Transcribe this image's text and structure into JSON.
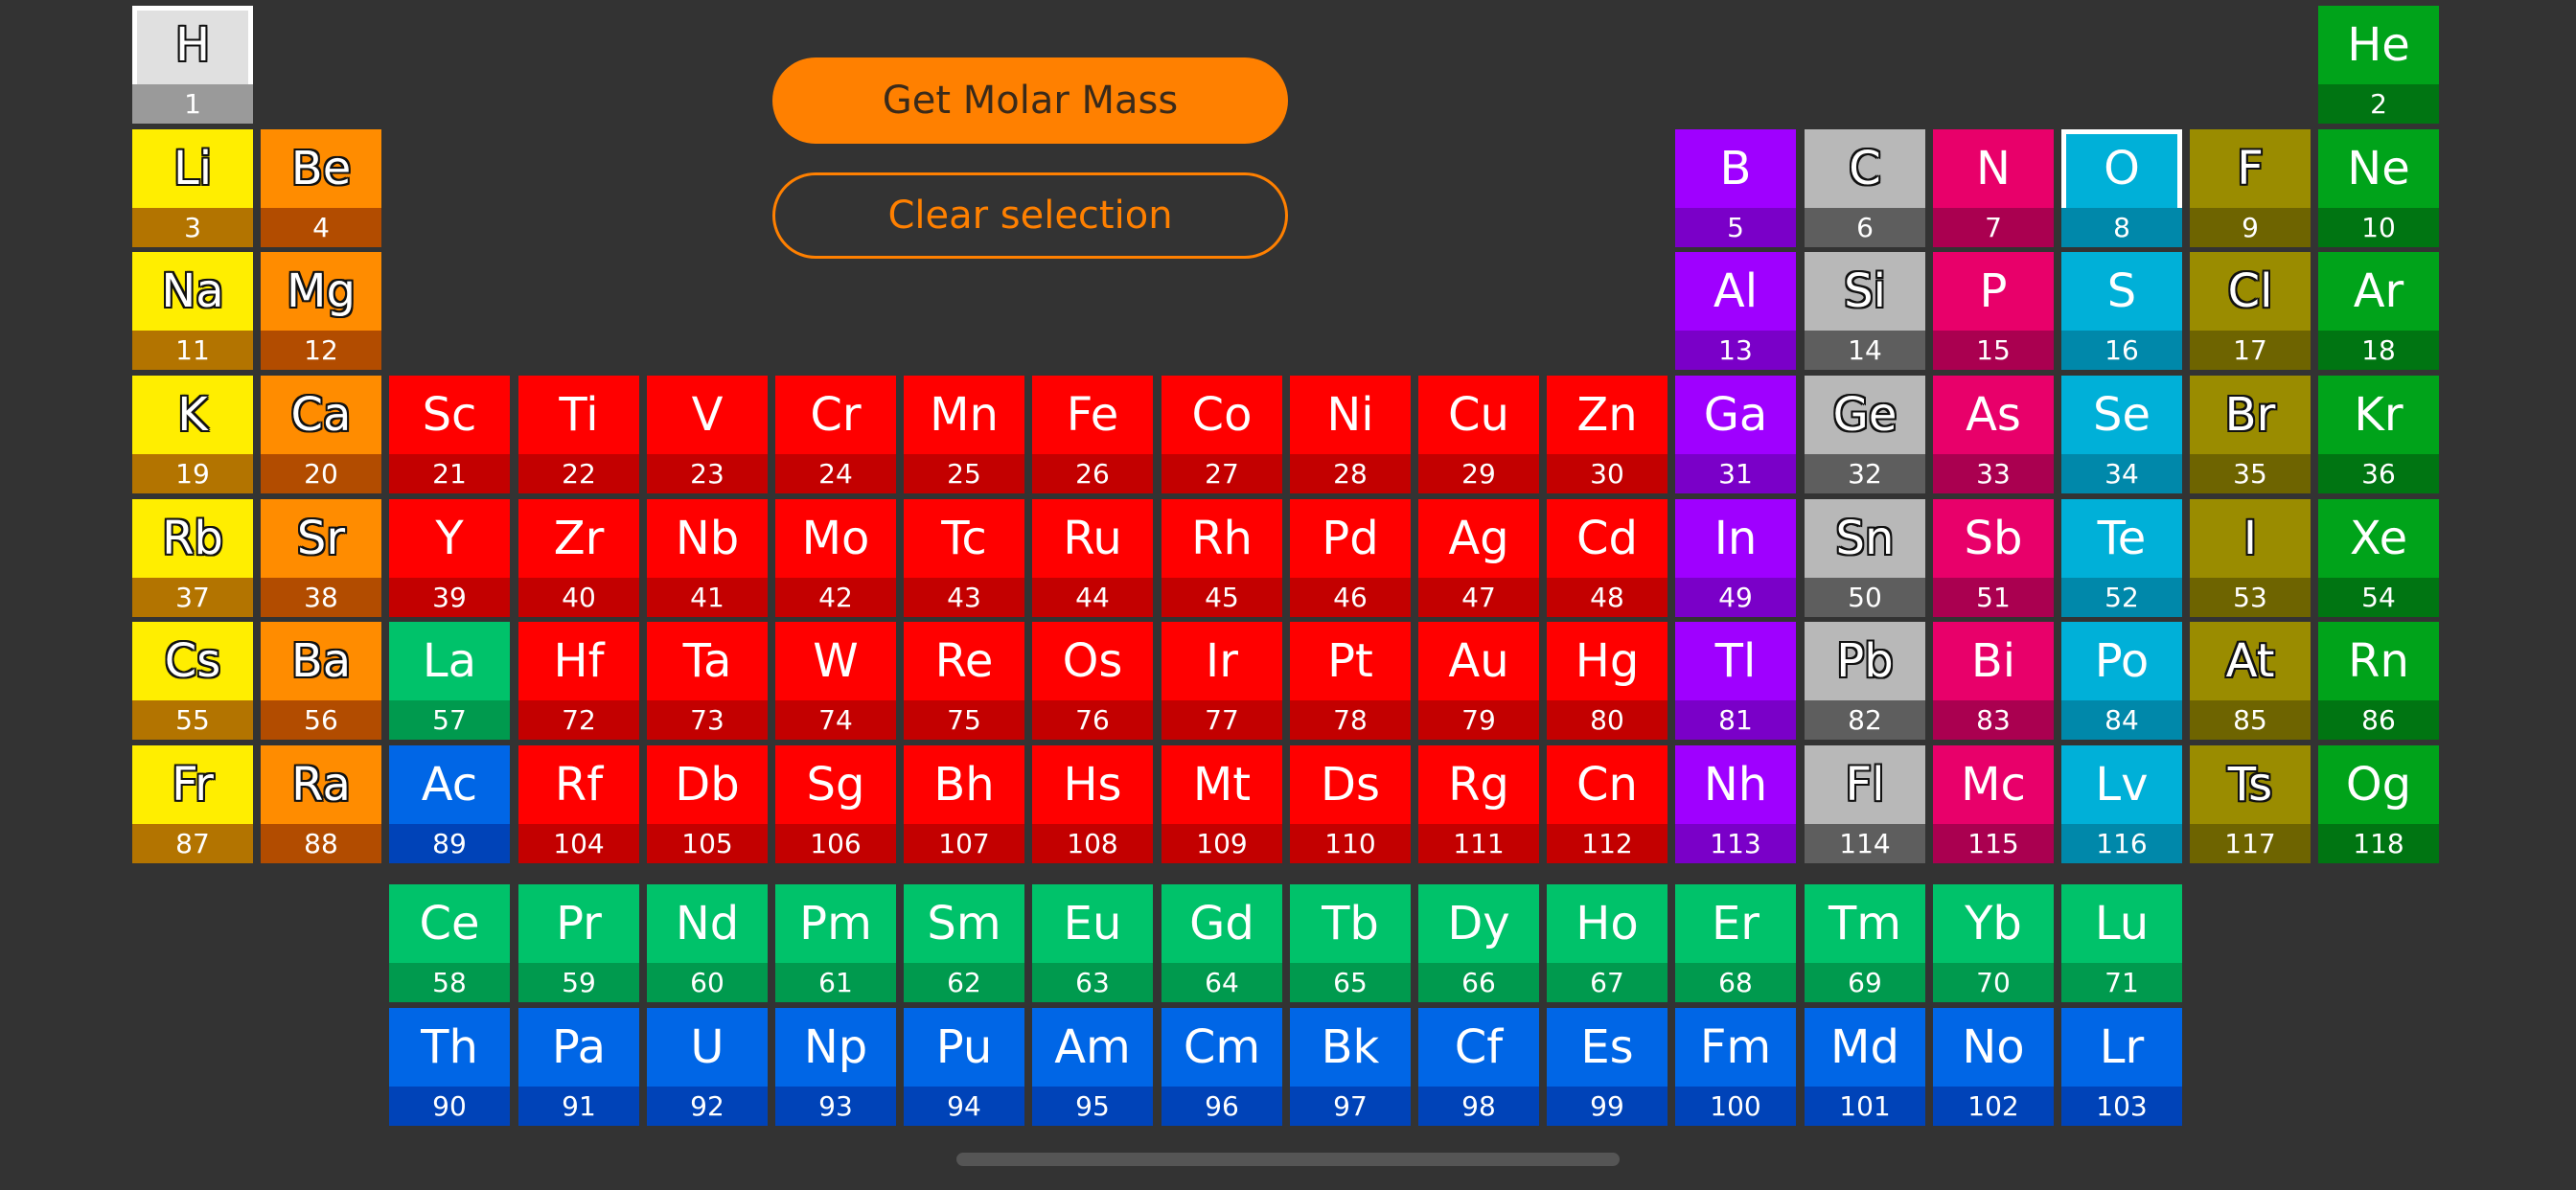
{
  "buttons": {
    "get_molar_mass": "Get Molar Mass",
    "clear_selection": "Clear selection"
  },
  "selected_elements": [
    "H",
    "O"
  ],
  "categories": {
    "hydrogen": {
      "top": "#e0e0e0",
      "bottom": "#9a9a9a",
      "outline": true
    },
    "alkali": {
      "top": "#ffee00",
      "bottom": "#b37400",
      "outline": true
    },
    "alkaline": {
      "top": "#ff8c00",
      "bottom": "#b24c00",
      "outline": true
    },
    "transition": {
      "top": "#ff0000",
      "bottom": "#c30000",
      "outline": false
    },
    "lanthanide": {
      "top": "#00c26a",
      "bottom": "#009a4e",
      "outline": false
    },
    "actinide": {
      "top": "#0066e6",
      "bottom": "#0043b8",
      "outline": false
    },
    "post_transition": {
      "top": "#9f00ff",
      "bottom": "#7a00c8",
      "outline": false
    },
    "metalloid": {
      "top": "#b8b8b8",
      "bottom": "#5e5e5e",
      "outline": true
    },
    "nonmetal": {
      "top": "#e8006a",
      "bottom": "#aa0050",
      "outline": false
    },
    "chalcogen": {
      "top": "#00b0d8",
      "bottom": "#0088aa",
      "outline": false
    },
    "halogen": {
      "top": "#9a8c00",
      "bottom": "#6e6400",
      "outline": true
    },
    "noble": {
      "top": "#00a31a",
      "bottom": "#007512",
      "outline": false
    }
  },
  "elements": [
    {
      "s": "H",
      "n": 1,
      "r": 0,
      "c": 0,
      "cat": "hydrogen"
    },
    {
      "s": "He",
      "n": 2,
      "r": 0,
      "c": 17,
      "cat": "noble"
    },
    {
      "s": "Li",
      "n": 3,
      "r": 1,
      "c": 0,
      "cat": "alkali"
    },
    {
      "s": "Be",
      "n": 4,
      "r": 1,
      "c": 1,
      "cat": "alkaline"
    },
    {
      "s": "B",
      "n": 5,
      "r": 1,
      "c": 12,
      "cat": "post_transition"
    },
    {
      "s": "C",
      "n": 6,
      "r": 1,
      "c": 13,
      "cat": "metalloid"
    },
    {
      "s": "N",
      "n": 7,
      "r": 1,
      "c": 14,
      "cat": "nonmetal"
    },
    {
      "s": "O",
      "n": 8,
      "r": 1,
      "c": 15,
      "cat": "chalcogen"
    },
    {
      "s": "F",
      "n": 9,
      "r": 1,
      "c": 16,
      "cat": "halogen"
    },
    {
      "s": "Ne",
      "n": 10,
      "r": 1,
      "c": 17,
      "cat": "noble"
    },
    {
      "s": "Na",
      "n": 11,
      "r": 2,
      "c": 0,
      "cat": "alkali"
    },
    {
      "s": "Mg",
      "n": 12,
      "r": 2,
      "c": 1,
      "cat": "alkaline"
    },
    {
      "s": "Al",
      "n": 13,
      "r": 2,
      "c": 12,
      "cat": "post_transition"
    },
    {
      "s": "Si",
      "n": 14,
      "r": 2,
      "c": 13,
      "cat": "metalloid"
    },
    {
      "s": "P",
      "n": 15,
      "r": 2,
      "c": 14,
      "cat": "nonmetal"
    },
    {
      "s": "S",
      "n": 16,
      "r": 2,
      "c": 15,
      "cat": "chalcogen"
    },
    {
      "s": "Cl",
      "n": 17,
      "r": 2,
      "c": 16,
      "cat": "halogen"
    },
    {
      "s": "Ar",
      "n": 18,
      "r": 2,
      "c": 17,
      "cat": "noble"
    },
    {
      "s": "K",
      "n": 19,
      "r": 3,
      "c": 0,
      "cat": "alkali"
    },
    {
      "s": "Ca",
      "n": 20,
      "r": 3,
      "c": 1,
      "cat": "alkaline"
    },
    {
      "s": "Sc",
      "n": 21,
      "r": 3,
      "c": 2,
      "cat": "transition"
    },
    {
      "s": "Ti",
      "n": 22,
      "r": 3,
      "c": 3,
      "cat": "transition"
    },
    {
      "s": "V",
      "n": 23,
      "r": 3,
      "c": 4,
      "cat": "transition"
    },
    {
      "s": "Cr",
      "n": 24,
      "r": 3,
      "c": 5,
      "cat": "transition"
    },
    {
      "s": "Mn",
      "n": 25,
      "r": 3,
      "c": 6,
      "cat": "transition"
    },
    {
      "s": "Fe",
      "n": 26,
      "r": 3,
      "c": 7,
      "cat": "transition"
    },
    {
      "s": "Co",
      "n": 27,
      "r": 3,
      "c": 8,
      "cat": "transition"
    },
    {
      "s": "Ni",
      "n": 28,
      "r": 3,
      "c": 9,
      "cat": "transition"
    },
    {
      "s": "Cu",
      "n": 29,
      "r": 3,
      "c": 10,
      "cat": "transition"
    },
    {
      "s": "Zn",
      "n": 30,
      "r": 3,
      "c": 11,
      "cat": "transition"
    },
    {
      "s": "Ga",
      "n": 31,
      "r": 3,
      "c": 12,
      "cat": "post_transition"
    },
    {
      "s": "Ge",
      "n": 32,
      "r": 3,
      "c": 13,
      "cat": "metalloid"
    },
    {
      "s": "As",
      "n": 33,
      "r": 3,
      "c": 14,
      "cat": "nonmetal"
    },
    {
      "s": "Se",
      "n": 34,
      "r": 3,
      "c": 15,
      "cat": "chalcogen"
    },
    {
      "s": "Br",
      "n": 35,
      "r": 3,
      "c": 16,
      "cat": "halogen"
    },
    {
      "s": "Kr",
      "n": 36,
      "r": 3,
      "c": 17,
      "cat": "noble"
    },
    {
      "s": "Rb",
      "n": 37,
      "r": 4,
      "c": 0,
      "cat": "alkali"
    },
    {
      "s": "Sr",
      "n": 38,
      "r": 4,
      "c": 1,
      "cat": "alkaline"
    },
    {
      "s": "Y",
      "n": 39,
      "r": 4,
      "c": 2,
      "cat": "transition"
    },
    {
      "s": "Zr",
      "n": 40,
      "r": 4,
      "c": 3,
      "cat": "transition"
    },
    {
      "s": "Nb",
      "n": 41,
      "r": 4,
      "c": 4,
      "cat": "transition"
    },
    {
      "s": "Mo",
      "n": 42,
      "r": 4,
      "c": 5,
      "cat": "transition"
    },
    {
      "s": "Tc",
      "n": 43,
      "r": 4,
      "c": 6,
      "cat": "transition"
    },
    {
      "s": "Ru",
      "n": 44,
      "r": 4,
      "c": 7,
      "cat": "transition"
    },
    {
      "s": "Rh",
      "n": 45,
      "r": 4,
      "c": 8,
      "cat": "transition"
    },
    {
      "s": "Pd",
      "n": 46,
      "r": 4,
      "c": 9,
      "cat": "transition"
    },
    {
      "s": "Ag",
      "n": 47,
      "r": 4,
      "c": 10,
      "cat": "transition"
    },
    {
      "s": "Cd",
      "n": 48,
      "r": 4,
      "c": 11,
      "cat": "transition"
    },
    {
      "s": "In",
      "n": 49,
      "r": 4,
      "c": 12,
      "cat": "post_transition"
    },
    {
      "s": "Sn",
      "n": 50,
      "r": 4,
      "c": 13,
      "cat": "metalloid"
    },
    {
      "s": "Sb",
      "n": 51,
      "r": 4,
      "c": 14,
      "cat": "nonmetal"
    },
    {
      "s": "Te",
      "n": 52,
      "r": 4,
      "c": 15,
      "cat": "chalcogen"
    },
    {
      "s": "I",
      "n": 53,
      "r": 4,
      "c": 16,
      "cat": "halogen"
    },
    {
      "s": "Xe",
      "n": 54,
      "r": 4,
      "c": 17,
      "cat": "noble"
    },
    {
      "s": "Cs",
      "n": 55,
      "r": 5,
      "c": 0,
      "cat": "alkali"
    },
    {
      "s": "Ba",
      "n": 56,
      "r": 5,
      "c": 1,
      "cat": "alkaline"
    },
    {
      "s": "La",
      "n": 57,
      "r": 5,
      "c": 2,
      "cat": "lanthanide"
    },
    {
      "s": "Hf",
      "n": 72,
      "r": 5,
      "c": 3,
      "cat": "transition"
    },
    {
      "s": "Ta",
      "n": 73,
      "r": 5,
      "c": 4,
      "cat": "transition"
    },
    {
      "s": "W",
      "n": 74,
      "r": 5,
      "c": 5,
      "cat": "transition"
    },
    {
      "s": "Re",
      "n": 75,
      "r": 5,
      "c": 6,
      "cat": "transition"
    },
    {
      "s": "Os",
      "n": 76,
      "r": 5,
      "c": 7,
      "cat": "transition"
    },
    {
      "s": "Ir",
      "n": 77,
      "r": 5,
      "c": 8,
      "cat": "transition"
    },
    {
      "s": "Pt",
      "n": 78,
      "r": 5,
      "c": 9,
      "cat": "transition"
    },
    {
      "s": "Au",
      "n": 79,
      "r": 5,
      "c": 10,
      "cat": "transition"
    },
    {
      "s": "Hg",
      "n": 80,
      "r": 5,
      "c": 11,
      "cat": "transition"
    },
    {
      "s": "Tl",
      "n": 81,
      "r": 5,
      "c": 12,
      "cat": "post_transition"
    },
    {
      "s": "Pb",
      "n": 82,
      "r": 5,
      "c": 13,
      "cat": "metalloid"
    },
    {
      "s": "Bi",
      "n": 83,
      "r": 5,
      "c": 14,
      "cat": "nonmetal"
    },
    {
      "s": "Po",
      "n": 84,
      "r": 5,
      "c": 15,
      "cat": "chalcogen"
    },
    {
      "s": "At",
      "n": 85,
      "r": 5,
      "c": 16,
      "cat": "halogen"
    },
    {
      "s": "Rn",
      "n": 86,
      "r": 5,
      "c": 17,
      "cat": "noble"
    },
    {
      "s": "Fr",
      "n": 87,
      "r": 6,
      "c": 0,
      "cat": "alkali"
    },
    {
      "s": "Ra",
      "n": 88,
      "r": 6,
      "c": 1,
      "cat": "alkaline"
    },
    {
      "s": "Ac",
      "n": 89,
      "r": 6,
      "c": 2,
      "cat": "actinide"
    },
    {
      "s": "Rf",
      "n": 104,
      "r": 6,
      "c": 3,
      "cat": "transition"
    },
    {
      "s": "Db",
      "n": 105,
      "r": 6,
      "c": 4,
      "cat": "transition"
    },
    {
      "s": "Sg",
      "n": 106,
      "r": 6,
      "c": 5,
      "cat": "transition"
    },
    {
      "s": "Bh",
      "n": 107,
      "r": 6,
      "c": 6,
      "cat": "transition"
    },
    {
      "s": "Hs",
      "n": 108,
      "r": 6,
      "c": 7,
      "cat": "transition"
    },
    {
      "s": "Mt",
      "n": 109,
      "r": 6,
      "c": 8,
      "cat": "transition"
    },
    {
      "s": "Ds",
      "n": 110,
      "r": 6,
      "c": 9,
      "cat": "transition"
    },
    {
      "s": "Rg",
      "n": 111,
      "r": 6,
      "c": 10,
      "cat": "transition"
    },
    {
      "s": "Cn",
      "n": 112,
      "r": 6,
      "c": 11,
      "cat": "transition"
    },
    {
      "s": "Nh",
      "n": 113,
      "r": 6,
      "c": 12,
      "cat": "post_transition"
    },
    {
      "s": "Fl",
      "n": 114,
      "r": 6,
      "c": 13,
      "cat": "metalloid"
    },
    {
      "s": "Mc",
      "n": 115,
      "r": 6,
      "c": 14,
      "cat": "nonmetal"
    },
    {
      "s": "Lv",
      "n": 116,
      "r": 6,
      "c": 15,
      "cat": "chalcogen"
    },
    {
      "s": "Ts",
      "n": 117,
      "r": 6,
      "c": 16,
      "cat": "halogen"
    },
    {
      "s": "Og",
      "n": 118,
      "r": 6,
      "c": 17,
      "cat": "noble"
    },
    {
      "s": "Ce",
      "n": 58,
      "r": 7,
      "c": 2,
      "cat": "lanthanide"
    },
    {
      "s": "Pr",
      "n": 59,
      "r": 7,
      "c": 3,
      "cat": "lanthanide"
    },
    {
      "s": "Nd",
      "n": 60,
      "r": 7,
      "c": 4,
      "cat": "lanthanide"
    },
    {
      "s": "Pm",
      "n": 61,
      "r": 7,
      "c": 5,
      "cat": "lanthanide"
    },
    {
      "s": "Sm",
      "n": 62,
      "r": 7,
      "c": 6,
      "cat": "lanthanide"
    },
    {
      "s": "Eu",
      "n": 63,
      "r": 7,
      "c": 7,
      "cat": "lanthanide"
    },
    {
      "s": "Gd",
      "n": 64,
      "r": 7,
      "c": 8,
      "cat": "lanthanide"
    },
    {
      "s": "Tb",
      "n": 65,
      "r": 7,
      "c": 9,
      "cat": "lanthanide"
    },
    {
      "s": "Dy",
      "n": 66,
      "r": 7,
      "c": 10,
      "cat": "lanthanide"
    },
    {
      "s": "Ho",
      "n": 67,
      "r": 7,
      "c": 11,
      "cat": "lanthanide"
    },
    {
      "s": "Er",
      "n": 68,
      "r": 7,
      "c": 12,
      "cat": "lanthanide"
    },
    {
      "s": "Tm",
      "n": 69,
      "r": 7,
      "c": 13,
      "cat": "lanthanide"
    },
    {
      "s": "Yb",
      "n": 70,
      "r": 7,
      "c": 14,
      "cat": "lanthanide"
    },
    {
      "s": "Lu",
      "n": 71,
      "r": 7,
      "c": 15,
      "cat": "lanthanide"
    },
    {
      "s": "Th",
      "n": 90,
      "r": 8,
      "c": 2,
      "cat": "actinide"
    },
    {
      "s": "Pa",
      "n": 91,
      "r": 8,
      "c": 3,
      "cat": "actinide"
    },
    {
      "s": "U",
      "n": 92,
      "r": 8,
      "c": 4,
      "cat": "actinide"
    },
    {
      "s": "Np",
      "n": 93,
      "r": 8,
      "c": 5,
      "cat": "actinide"
    },
    {
      "s": "Pu",
      "n": 94,
      "r": 8,
      "c": 6,
      "cat": "actinide"
    },
    {
      "s": "Am",
      "n": 95,
      "r": 8,
      "c": 7,
      "cat": "actinide"
    },
    {
      "s": "Cm",
      "n": 96,
      "r": 8,
      "c": 8,
      "cat": "actinide"
    },
    {
      "s": "Bk",
      "n": 97,
      "r": 8,
      "c": 9,
      "cat": "actinide"
    },
    {
      "s": "Cf",
      "n": 98,
      "r": 8,
      "c": 10,
      "cat": "actinide"
    },
    {
      "s": "Es",
      "n": 99,
      "r": 8,
      "c": 11,
      "cat": "actinide"
    },
    {
      "s": "Fm",
      "n": 100,
      "r": 8,
      "c": 12,
      "cat": "actinide"
    },
    {
      "s": "Md",
      "n": 101,
      "r": 8,
      "c": 13,
      "cat": "actinide"
    },
    {
      "s": "No",
      "n": 102,
      "r": 8,
      "c": 14,
      "cat": "actinide"
    },
    {
      "s": "Lr",
      "n": 103,
      "r": 8,
      "c": 15,
      "cat": "actinide"
    }
  ]
}
